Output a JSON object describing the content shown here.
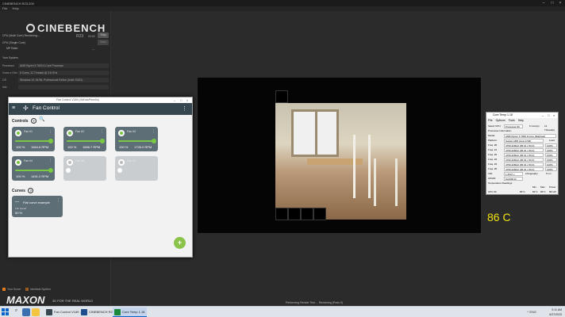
{
  "cinebench": {
    "title": "CINEBENCH R23.200",
    "menu": [
      "File",
      "Help"
    ],
    "logo": "CINEBENCH",
    "version": "R23",
    "rows": [
      {
        "label": "CPU (Multi Core)  Rendering...",
        "value": "00:02",
        "button": "Stop"
      },
      {
        "label": "CPU (Single Core)",
        "value": "",
        "button": "Start"
      },
      {
        "label": "MP Ratio",
        "value": "---",
        "button": ""
      }
    ],
    "system_header": "Your System",
    "system": [
      {
        "k": "Processor",
        "v": "AMD Ryzen 5 7600 6-Core Processor"
      },
      {
        "k": "Cores x GHz",
        "v": "6 Cores, 12 Threads @ 3.8 GHz"
      },
      {
        "k": "OS",
        "v": "Windows 10, 64 Bit, Professional Edition (build 22621)"
      },
      {
        "k": "Info",
        "v": ""
      }
    ],
    "legend": [
      "Your Score",
      "Identical System"
    ],
    "maxon": "MAXON",
    "maxon_tag": "3D FOR THE REAL WORLD",
    "status": "Performing Render Test ... Rendering (Pass 9)",
    "render_temp": "86 C"
  },
  "fancontrol": {
    "window_title": "Fan Control V189 (GitHub/Rem0o)",
    "app_title": "Fan Control",
    "controls_label": "Controls",
    "curves_label": "Curves",
    "fans": [
      {
        "name": "Fan #1",
        "pct": "100 %",
        "rpm": "1664.6 RPM",
        "active": true
      },
      {
        "name": "Fan #2",
        "pct": "100 %",
        "rpm": "1668.7 RPM",
        "active": true
      },
      {
        "name": "Fan #3",
        "pct": "100 %",
        "rpm": "1726.0 RPM",
        "active": true
      },
      {
        "name": "Fan #4",
        "pct": "100 %",
        "rpm": "1491.2 RPM",
        "active": true
      },
      {
        "name": "Fan #5",
        "pct": "",
        "rpm": "",
        "active": false
      },
      {
        "name": "Fan #6",
        "pct": "",
        "rpm": "",
        "active": false
      }
    ],
    "curve": {
      "name": "Flat curve example",
      "label": "Fan speed",
      "value": "50 %"
    },
    "fab": "+"
  },
  "coretemp": {
    "title": "Core Temp 1.18",
    "menu": [
      "File",
      "Options",
      "Tools",
      "Help"
    ],
    "select_cpu": "Select CPU:",
    "processor_id": "Processor #0",
    "cores_label": "6 Core(s)",
    "threads_label": "12 Thread(s)",
    "proc_info": "Processor Information",
    "model": "AMD Ryzen 5 7600 6-Core (Raphael)",
    "platform": "Socket AM5 (LGA 1718)",
    "load_label": "Load",
    "freqs": [
      {
        "k": "Freq. #0",
        "v": "4750.42MHz (95.01 x 50.0)",
        "l": "100%"
      },
      {
        "k": "Freq. #1",
        "v": "4750.42MHz (95.01 x 50.0)",
        "l": "100%"
      },
      {
        "k": "Freq. #2",
        "v": "4750.42MHz (95.01 x 50.0)",
        "l": "100%"
      },
      {
        "k": "Freq. #3",
        "v": "4750.42MHz (95.01 x 50.0)",
        "l": "100%"
      },
      {
        "k": "Freq. #4",
        "v": "4750.42MHz (95.01 x 50.0)",
        "l": "100%"
      },
      {
        "k": "Freq. #5",
        "v": "4750.42MHz (95.01 x 50.0)",
        "l": "100%"
      }
    ],
    "vid": "1.2537 v",
    "lithography": "5 nm",
    "cpuid": "0xA60F12",
    "temps_header": "Temperature Readings",
    "temp_cols": [
      "Min.",
      "Max.",
      "Power"
    ],
    "cpu_row": {
      "k": "CPU #0",
      "v": "86°C",
      "min": "82°C",
      "max": "86°C",
      "power": "88.1W"
    }
  },
  "taskbar": {
    "apps": [
      {
        "label": "Fan Control V189 -",
        "color": "#37474f",
        "active": false
      },
      {
        "label": "CINEBENCH R23",
        "color": "#1f4e8c",
        "active": false
      },
      {
        "label": "Core Temp 1.18",
        "color": "#1a8a3a",
        "active": true
      }
    ],
    "time": "9:11 AM",
    "date": "6/27/2023",
    "tray": "^ ENG"
  }
}
